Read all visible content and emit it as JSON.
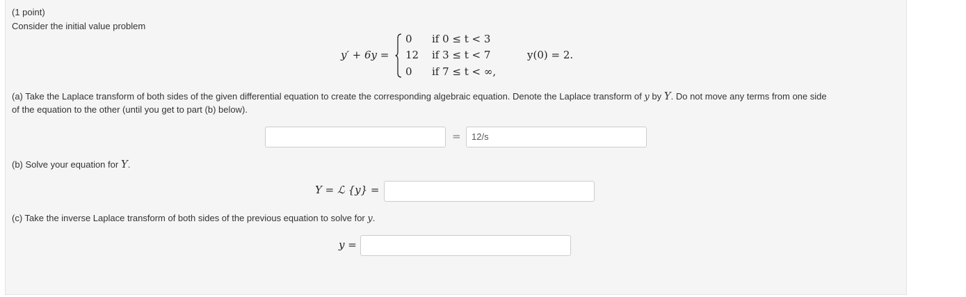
{
  "problem": {
    "points": "(1 point)",
    "intro": "Consider the initial value problem",
    "equation": {
      "lhs": "y′ + 6y =",
      "cases": [
        {
          "value": "0",
          "condition": "if 0 ≤ t < 3"
        },
        {
          "value": "12",
          "condition": "if 3 ≤ t < 7"
        },
        {
          "value": "0",
          "condition": "if 7 ≤ t < ∞,"
        }
      ],
      "initial_condition": "y(0) = 2."
    }
  },
  "part_a": {
    "text_1": "(a) Take the Laplace transform of both sides of the given differential equation to create the corresponding algebraic equation. Denote the Laplace transform of ",
    "var_y": "y",
    "text_2": " by ",
    "var_Y": "Y",
    "text_3": ". Do not move any terms from one side",
    "text_line2": "of the equation to the other (until you get to part (b) below).",
    "equals": "=",
    "lhs_value": "",
    "rhs_value": "12/s"
  },
  "part_b": {
    "text": "(b) Solve your equation for ",
    "var_Y": "Y",
    "period": ".",
    "label": "Y = ℒ {y} =",
    "answer_value": ""
  },
  "part_c": {
    "text": "(c) Take the inverse Laplace transform of both sides of the previous equation to solve for ",
    "var_y": "y",
    "period": ".",
    "label": "y =",
    "answer_value": ""
  }
}
